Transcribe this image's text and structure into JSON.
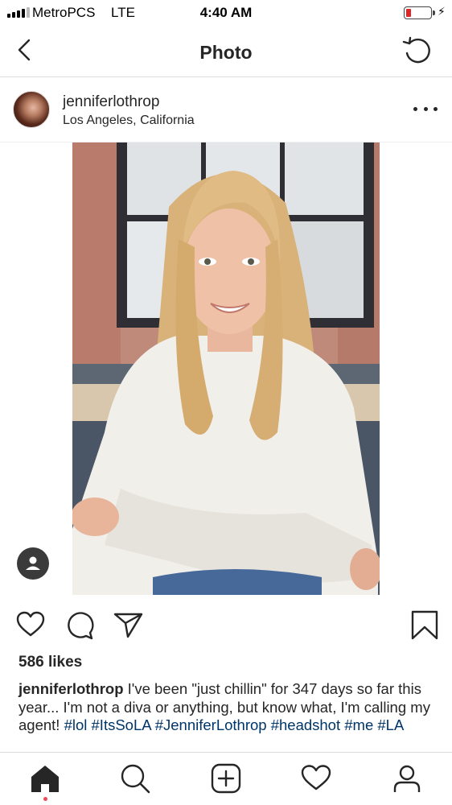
{
  "status_bar": {
    "carrier": "MetroPCS",
    "network": "LTE",
    "time": "4:40 AM",
    "battery_level": 0.2,
    "battery_color": "#e22424"
  },
  "header": {
    "title": "Photo",
    "back_icon": "chevron-left-icon",
    "refresh_icon": "refresh-icon"
  },
  "post": {
    "username": "jenniferlothrop",
    "location": "Los Angeles, California",
    "more_icon": "more-horizontal-icon",
    "photo_alt": "portrait",
    "tag_icon": "person-tag-icon"
  },
  "actions": {
    "like_icon": "heart-icon",
    "comment_icon": "comment-icon",
    "share_icon": "send-icon",
    "save_icon": "bookmark-icon"
  },
  "likes": "586 likes",
  "caption": {
    "username": "jenniferlothrop",
    "text": " I've been \"just chillin\" for 347 days so far this year... I'm not a diva or anything, but know what, I'm calling my agent! ",
    "hashtags": "#lol #ItsSoLA #JenniferLothrop #headshot #me #LA"
  },
  "tab_bar": {
    "items": [
      "home-icon",
      "search-icon",
      "add-post-icon",
      "activity-heart-icon",
      "profile-icon"
    ],
    "active": "home-icon",
    "notification_color": "#ed4956"
  }
}
